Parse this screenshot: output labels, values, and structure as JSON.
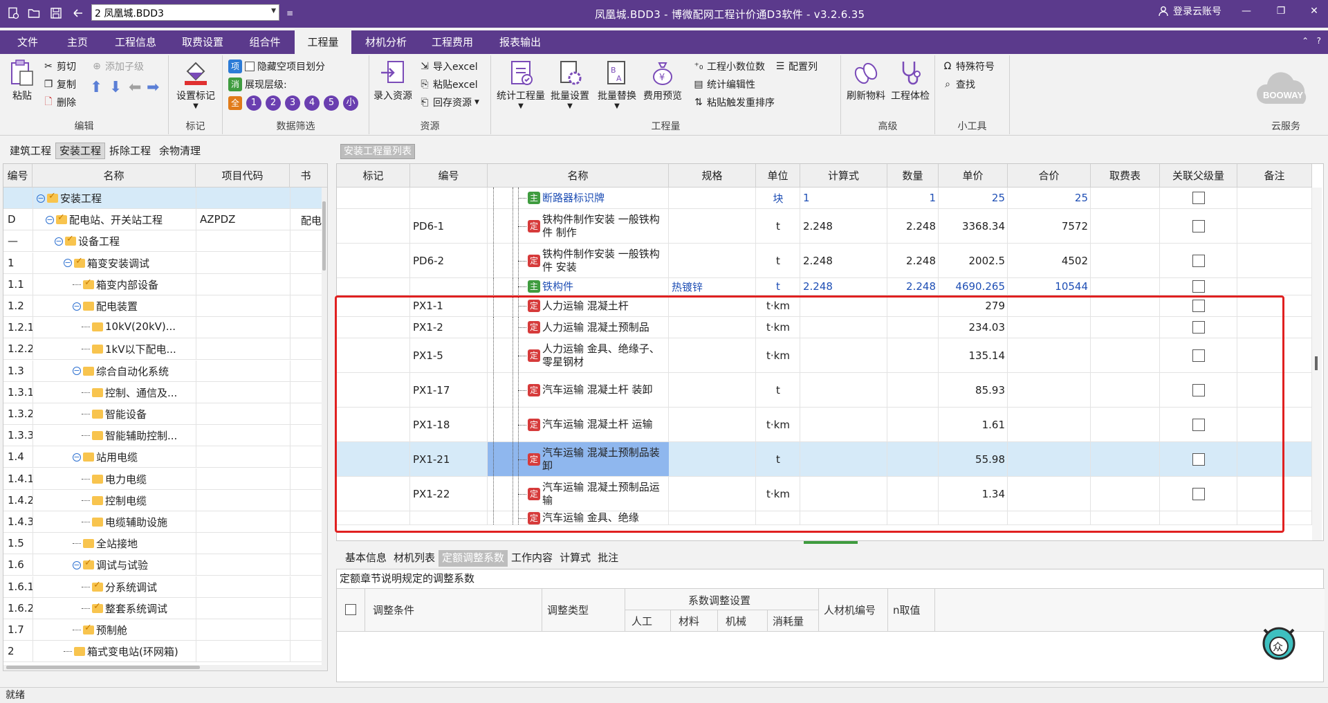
{
  "window": {
    "file_selected": "2 凤凰城.BDD3",
    "title": "凤凰城.BDD3 - 博微配网工程计价通D3软件 - v3.2.6.35",
    "login": "登录云账号"
  },
  "menu": {
    "tabs": [
      "文件",
      "主页",
      "工程信息",
      "取费设置",
      "组合件",
      "工程量",
      "材机分析",
      "工程费用",
      "报表输出"
    ],
    "active": "工程量"
  },
  "ribbon": {
    "edit": {
      "label": "编辑",
      "paste": "粘贴",
      "cut": "剪切",
      "copy": "复制",
      "delete": "删除",
      "add_child": "添加子级"
    },
    "mark": {
      "label": "标记",
      "set_mark": "设置标记"
    },
    "filter": {
      "label": "数据筛选",
      "hide_empty": "隐藏空项目划分",
      "show_level": "展现层级:",
      "chip_item": "项",
      "chip_cancel": "消",
      "chip_all": "全",
      "levels": [
        "1",
        "2",
        "3",
        "4",
        "5",
        "小"
      ]
    },
    "resource": {
      "label": "资源",
      "input": "录入资源",
      "import_excel": "导入excel",
      "paste_excel": "粘贴excel",
      "save_back": "回存资源"
    },
    "quantity": {
      "label": "工程量",
      "stat": "统计工程量",
      "batch_set": "批量设置",
      "batch_replace": "批量替换",
      "fee_preview": "费用预览",
      "decimals": "工程小数位数",
      "config_cols": "配置列",
      "stat_editor": "统计编辑性",
      "paste_sort": "粘贴触发重排序"
    },
    "advanced": {
      "label": "高级",
      "refresh": "刷新物料",
      "check": "工程体检"
    },
    "tools": {
      "label": "小工具",
      "special": "特殊符号",
      "find": "查找"
    },
    "cloud": {
      "label": "云服务",
      "brand": "BOOWAY"
    }
  },
  "left": {
    "tabs": [
      "建筑工程",
      "安装工程",
      "拆除工程",
      "余物清理"
    ],
    "active_tab": "安装工程",
    "headers": [
      "编号",
      "名称",
      "项目代码",
      "书"
    ],
    "rows": [
      {
        "code": "",
        "name": "安装工程",
        "proj": "",
        "x": ""
      },
      {
        "code": "D",
        "name": "配电站、开关站工程",
        "proj": "AZPDZ",
        "x": "配电"
      },
      {
        "code": "—",
        "name": "设备工程",
        "proj": "",
        "x": ""
      },
      {
        "code": "1",
        "name": "箱变安装调试",
        "proj": "",
        "x": ""
      },
      {
        "code": "1.1",
        "name": "箱变内部设备",
        "proj": "",
        "x": ""
      },
      {
        "code": "1.2",
        "name": "配电装置",
        "proj": "",
        "x": ""
      },
      {
        "code": "1.2.1",
        "name": "10kV(20kV)...",
        "proj": "",
        "x": ""
      },
      {
        "code": "1.2.2",
        "name": "1kV以下配电...",
        "proj": "",
        "x": ""
      },
      {
        "code": "1.3",
        "name": "综合自动化系统",
        "proj": "",
        "x": ""
      },
      {
        "code": "1.3.1",
        "name": "控制、通信及...",
        "proj": "",
        "x": ""
      },
      {
        "code": "1.3.2",
        "name": "智能设备",
        "proj": "",
        "x": ""
      },
      {
        "code": "1.3.3",
        "name": "智能辅助控制...",
        "proj": "",
        "x": ""
      },
      {
        "code": "1.4",
        "name": "站用电缆",
        "proj": "",
        "x": ""
      },
      {
        "code": "1.4.1",
        "name": "电力电缆",
        "proj": "",
        "x": ""
      },
      {
        "code": "1.4.2",
        "name": "控制电缆",
        "proj": "",
        "x": ""
      },
      {
        "code": "1.4.3",
        "name": "电缆辅助设施",
        "proj": "",
        "x": ""
      },
      {
        "code": "1.5",
        "name": "全站接地",
        "proj": "",
        "x": ""
      },
      {
        "code": "1.6",
        "name": "调试与试验",
        "proj": "",
        "x": ""
      },
      {
        "code": "1.6.1",
        "name": "分系统调试",
        "proj": "",
        "x": ""
      },
      {
        "code": "1.6.2",
        "name": "整套系统调试",
        "proj": "",
        "x": ""
      },
      {
        "code": "1.7",
        "name": "预制舱",
        "proj": "",
        "x": ""
      },
      {
        "code": "2",
        "name": "箱式变电站(环网箱)",
        "proj": "",
        "x": ""
      }
    ]
  },
  "right": {
    "caption": "安装工程量列表",
    "headers": [
      "标记",
      "编号",
      "名称",
      "规格",
      "单位",
      "计算式",
      "数量",
      "单价",
      "合价",
      "取费表",
      "关联父级量",
      "备注"
    ],
    "rows": [
      {
        "mark": "",
        "code": "",
        "type": "主",
        "name": "断路器标识牌",
        "spec": "",
        "unit": "块",
        "formula": "1",
        "qty": "1",
        "price": "25",
        "total": "25"
      },
      {
        "mark": "",
        "code": "PD6-1",
        "type": "定",
        "name": "铁构件制作安装 一般铁构件 制作",
        "spec": "",
        "unit": "t",
        "formula": "2.248",
        "qty": "2.248",
        "price": "3368.34",
        "total": "7572"
      },
      {
        "mark": "",
        "code": "PD6-2",
        "type": "定",
        "name": "铁构件制作安装 一般铁构件 安装",
        "spec": "",
        "unit": "t",
        "formula": "2.248",
        "qty": "2.248",
        "price": "2002.5",
        "total": "4502"
      },
      {
        "mark": "",
        "code": "",
        "type": "主",
        "name": "铁构件",
        "spec": "热镀锌",
        "unit": "t",
        "formula": "2.248",
        "qty": "2.248",
        "price": "4690.265",
        "total": "10544"
      },
      {
        "mark": "",
        "code": "PX1-1",
        "type": "定",
        "name": "人力运输 混凝土杆",
        "spec": "",
        "unit": "t·km",
        "formula": "",
        "qty": "",
        "price": "279",
        "total": ""
      },
      {
        "mark": "",
        "code": "PX1-2",
        "type": "定",
        "name": "人力运输 混凝土预制品",
        "spec": "",
        "unit": "t·km",
        "formula": "",
        "qty": "",
        "price": "234.03",
        "total": ""
      },
      {
        "mark": "",
        "code": "PX1-5",
        "type": "定",
        "name": "人力运输 金具、绝缘子、零星钢材",
        "spec": "",
        "unit": "t·km",
        "formula": "",
        "qty": "",
        "price": "135.14",
        "total": ""
      },
      {
        "mark": "",
        "code": "PX1-17",
        "type": "定",
        "name": "汽车运输 混凝土杆 装卸",
        "spec": "",
        "unit": "t",
        "formula": "",
        "qty": "",
        "price": "85.93",
        "total": ""
      },
      {
        "mark": "",
        "code": "PX1-18",
        "type": "定",
        "name": "汽车运输 混凝土杆 运输",
        "spec": "",
        "unit": "t·km",
        "formula": "",
        "qty": "",
        "price": "1.61",
        "total": ""
      },
      {
        "mark": "",
        "code": "PX1-21",
        "type": "定",
        "name": "汽车运输 混凝土预制品装卸",
        "spec": "",
        "unit": "t",
        "formula": "",
        "qty": "",
        "price": "55.98",
        "total": ""
      },
      {
        "mark": "",
        "code": "PX1-22",
        "type": "定",
        "name": "汽车运输 混凝土预制品运输",
        "spec": "",
        "unit": "t·km",
        "formula": "",
        "qty": "",
        "price": "1.34",
        "total": ""
      },
      {
        "mark": "",
        "code": "",
        "type": "定",
        "name": "汽车运输 金具、绝缘",
        "spec": "",
        "unit": "",
        "formula": "",
        "qty": "",
        "price": "",
        "total": ""
      }
    ]
  },
  "bottom": {
    "tabs": [
      "基本信息",
      "材机列表",
      "定额调整系数",
      "工作内容",
      "计算式",
      "批注"
    ],
    "active_tab": "定额调整系数",
    "caption": "定额章节说明规定的调整系数",
    "headers": {
      "condition": "调整条件",
      "type": "调整类型",
      "coef_group": "系数调整设置",
      "labor": "人工",
      "material": "材料",
      "machine": "机械",
      "consumable": "消耗量",
      "rcj_code": "人材机编号",
      "n_value": "n取值"
    }
  },
  "status": {
    "text": "就绪"
  },
  "colors": {
    "brand": "#5b3a8c",
    "highlight": "#e02020",
    "selected_row": "#d6eaf8"
  }
}
